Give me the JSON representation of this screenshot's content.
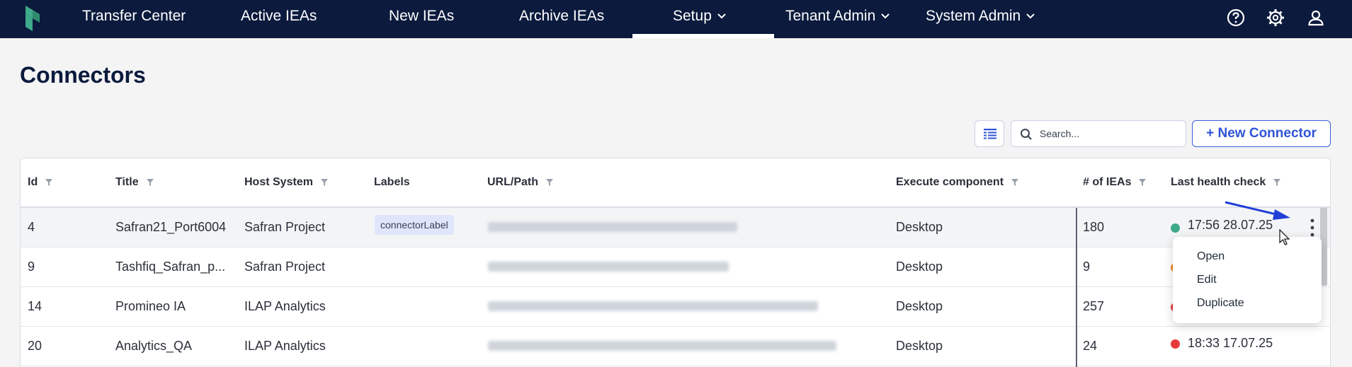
{
  "nav": {
    "logo": "app-logo",
    "items": [
      {
        "label": "Transfer Center"
      },
      {
        "label": "Active IEAs"
      },
      {
        "label": "New IEAs"
      },
      {
        "label": "Archive IEAs"
      },
      {
        "label": "Setup",
        "active": true
      },
      {
        "label": "Tenant Admin"
      },
      {
        "label": "System Admin"
      }
    ],
    "icons": [
      "help-icon",
      "gear-icon",
      "user-icon"
    ]
  },
  "page": {
    "title": "Connectors"
  },
  "toolbar": {
    "search_placeholder": "Search...",
    "new_button_label": "+ New Connector"
  },
  "table": {
    "columns": [
      "Id",
      "Title",
      "Host System",
      "Labels",
      "URL/Path",
      "Execute component",
      "# of IEAs",
      "Last health check"
    ],
    "rows": [
      {
        "id": "4",
        "title": "Safran21_Port6004",
        "host": "Safran Project",
        "label": "connectorLabel",
        "execute": "Desktop",
        "ieas": "180",
        "health": "17:56 28.07.25",
        "status": "ok"
      },
      {
        "id": "9",
        "title": "Tashfiq_Safran_p...",
        "host": "Safran Project",
        "label": "",
        "execute": "Desktop",
        "ieas": "9",
        "health": "",
        "status": "warn"
      },
      {
        "id": "14",
        "title": "Promineo IA",
        "host": "ILAP Analytics",
        "label": "",
        "execute": "Desktop",
        "ieas": "257",
        "health": "",
        "status": "error"
      },
      {
        "id": "20",
        "title": "Analytics_QA",
        "host": "ILAP Analytics",
        "label": "",
        "execute": "Desktop",
        "ieas": "24",
        "health": "18:33 17.07.25",
        "status": "error"
      }
    ]
  },
  "menu": {
    "items": [
      "Open",
      "Edit",
      "Duplicate"
    ]
  },
  "colors": {
    "nav_bg": "#0b1a3d",
    "accent": "#2f54d6",
    "status_ok": "#3daa8a",
    "status_warn": "#f08a24",
    "status_error": "#e5383b"
  }
}
